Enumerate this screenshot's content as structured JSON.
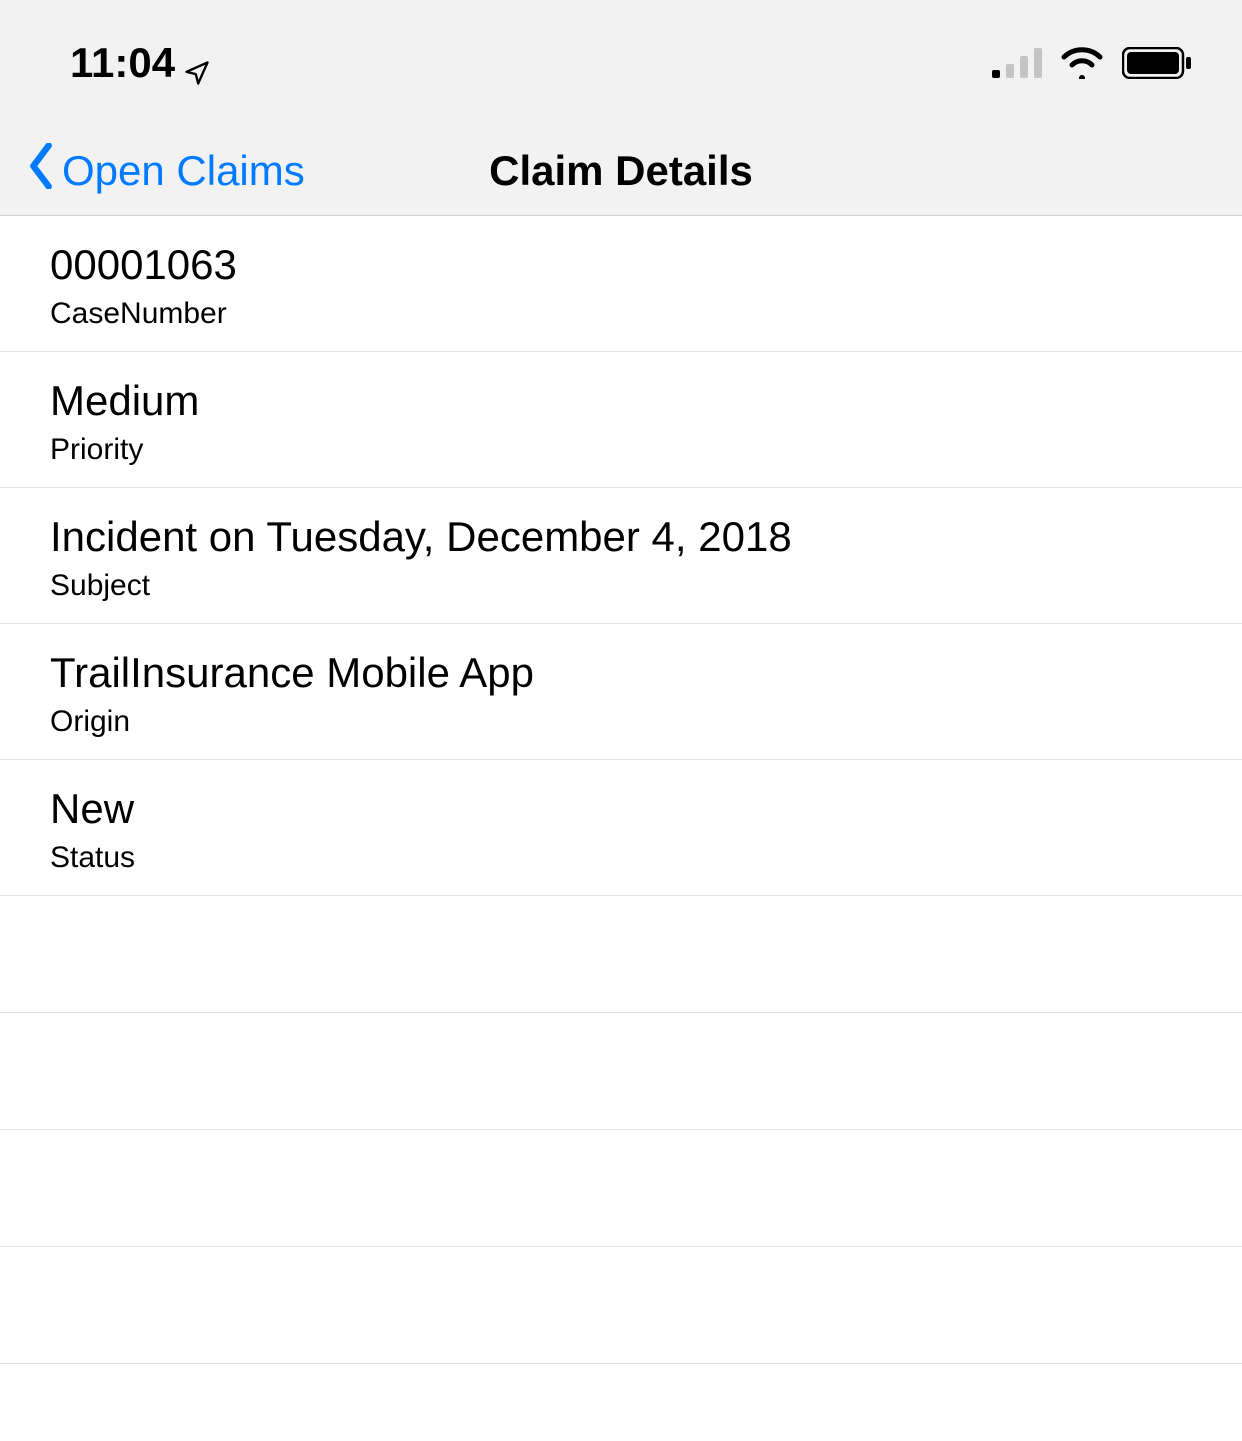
{
  "statusBar": {
    "time": "11:04"
  },
  "nav": {
    "backLabel": "Open Claims",
    "title": "Claim Details"
  },
  "rows": [
    {
      "value": "00001063",
      "label": "CaseNumber"
    },
    {
      "value": "Medium",
      "label": "Priority"
    },
    {
      "value": "Incident on Tuesday, December 4, 2018",
      "label": "Subject"
    },
    {
      "value": "TrailInsurance Mobile App",
      "label": "Origin"
    },
    {
      "value": "New",
      "label": "Status"
    }
  ]
}
